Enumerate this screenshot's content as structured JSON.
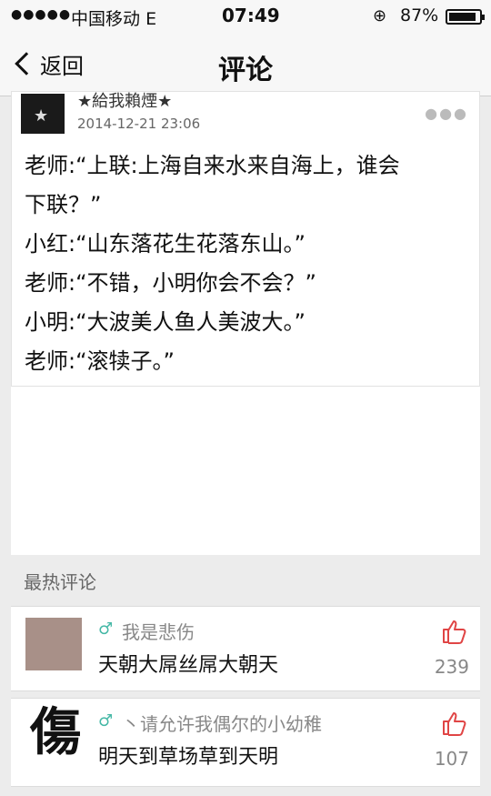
{
  "status": {
    "carrier": "中国移动",
    "network": "E",
    "time": "07:49",
    "battery": "87%"
  },
  "nav": {
    "back": "返回",
    "title": "评论"
  },
  "post": {
    "author": "★給我賴煙★",
    "date": "2014-12-21 23:06",
    "lines": [
      "老师:“上联:上海自来水来自海上，谁会",
      "下联？”",
      "小红:“山东落花生花落东山。”",
      "老师:“不错，小明你会不会？”",
      "小明:“大波美人鱼人美波大。”",
      "老师:“滚犊子。”"
    ]
  },
  "section": {
    "title": "最热评论"
  },
  "comments": [
    {
      "user": "我是悲伤",
      "text": "天朝大屌丝屌大朝天",
      "likes": "239",
      "gender": "♂"
    },
    {
      "user": "丶请允许我偶尔的小幼稚",
      "text": "明天到草场草到天明",
      "likes": "107",
      "gender": "♂",
      "avatar_char": "傷"
    }
  ],
  "colors": {
    "accent_like": "#e04545",
    "gender": "#45b8a6"
  }
}
